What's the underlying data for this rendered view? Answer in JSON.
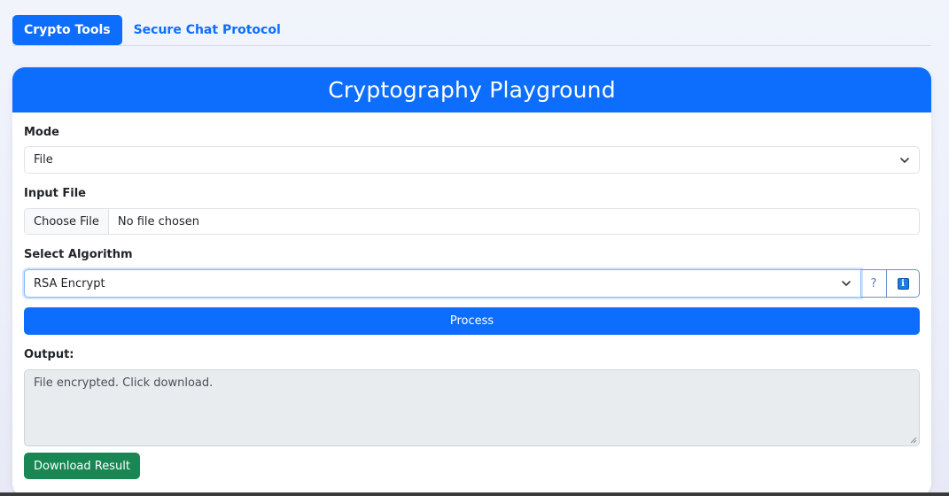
{
  "tabs": [
    {
      "label": "Crypto Tools",
      "active": true
    },
    {
      "label": "Secure Chat Protocol",
      "active": false
    }
  ],
  "card": {
    "title": "Cryptography Playground"
  },
  "form": {
    "mode_label": "Mode",
    "mode_value": "File",
    "input_file_label": "Input File",
    "choose_file_label": "Choose File",
    "file_name": "No file chosen",
    "algorithm_label": "Select Algorithm",
    "algorithm_value": "RSA Encrypt",
    "help_label": "?",
    "info_icon_text": "i",
    "process_label": "Process",
    "output_label": "Output:",
    "output_value": "File encrypted. Click download.",
    "download_label": "Download Result"
  },
  "colors": {
    "primary": "#0d6efd",
    "success": "#198754",
    "output_bg": "#e9ecef"
  },
  "icons": {
    "select_chevron": "chevron-down-icon",
    "info": "info-icon",
    "grip": "resize-grip-icon"
  }
}
